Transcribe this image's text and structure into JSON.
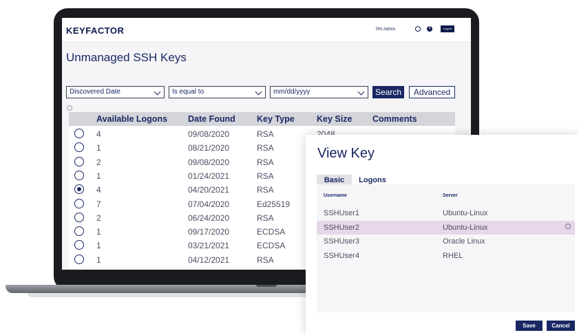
{
  "app": {
    "logo": "KEYFACTOR",
    "user": "PKI Admin",
    "logout_label": "Logout",
    "help_glyph": "?",
    "colors": {
      "brand": "#1a2763",
      "selected_row": "#e8d6ea"
    }
  },
  "page": {
    "title": "Unmanaged SSH Keys"
  },
  "filters": {
    "field": "Discovered Date",
    "operator": "Is equal to",
    "date_placeholder": "mm/dd/yyyy",
    "search_label": "Search",
    "advanced_label": "Advanced"
  },
  "table": {
    "columns": [
      "Available Logons",
      "Date Found",
      "Key Type",
      "Key Size",
      "Comments"
    ],
    "rows": [
      {
        "selected": false,
        "logons": "4",
        "date": "09/08/2020",
        "type": "RSA",
        "size": "2048"
      },
      {
        "selected": false,
        "logons": "1",
        "date": "08/21/2020",
        "type": "RSA",
        "size": ""
      },
      {
        "selected": false,
        "logons": "2",
        "date": "09/08/2020",
        "type": "RSA",
        "size": ""
      },
      {
        "selected": false,
        "logons": "1",
        "date": "01/24/2021",
        "type": "RSA",
        "size": ""
      },
      {
        "selected": true,
        "logons": "4",
        "date": "04/20/2021",
        "type": "RSA",
        "size": ""
      },
      {
        "selected": false,
        "logons": "7",
        "date": "07/04/2020",
        "type": "Ed25519",
        "size": ""
      },
      {
        "selected": false,
        "logons": "2",
        "date": "06/24/2020",
        "type": "RSA",
        "size": ""
      },
      {
        "selected": false,
        "logons": "1",
        "date": "09/17/2020",
        "type": "ECDSA",
        "size": ""
      },
      {
        "selected": false,
        "logons": "1",
        "date": "03/21/2021",
        "type": "ECDSA",
        "size": ""
      },
      {
        "selected": false,
        "logons": "1",
        "date": "04/12/2021",
        "type": "RSA",
        "size": ""
      }
    ]
  },
  "dialog": {
    "title": "View Key",
    "tabs": [
      "Basic",
      "Logons"
    ],
    "active_tab": "Logons",
    "columns": [
      "Username",
      "Server"
    ],
    "logons": [
      {
        "username": "SSHUser1",
        "server": "Ubuntu-Linux",
        "selected": false
      },
      {
        "username": "SSHUser2",
        "server": "Ubuntu-Linux",
        "selected": true
      },
      {
        "username": "SSHUser3",
        "server": "Oracle Linux",
        "selected": false
      },
      {
        "username": "SSHUser4",
        "server": "RHEL",
        "selected": false
      }
    ],
    "save_label": "Save",
    "cancel_label": "Cancel"
  }
}
